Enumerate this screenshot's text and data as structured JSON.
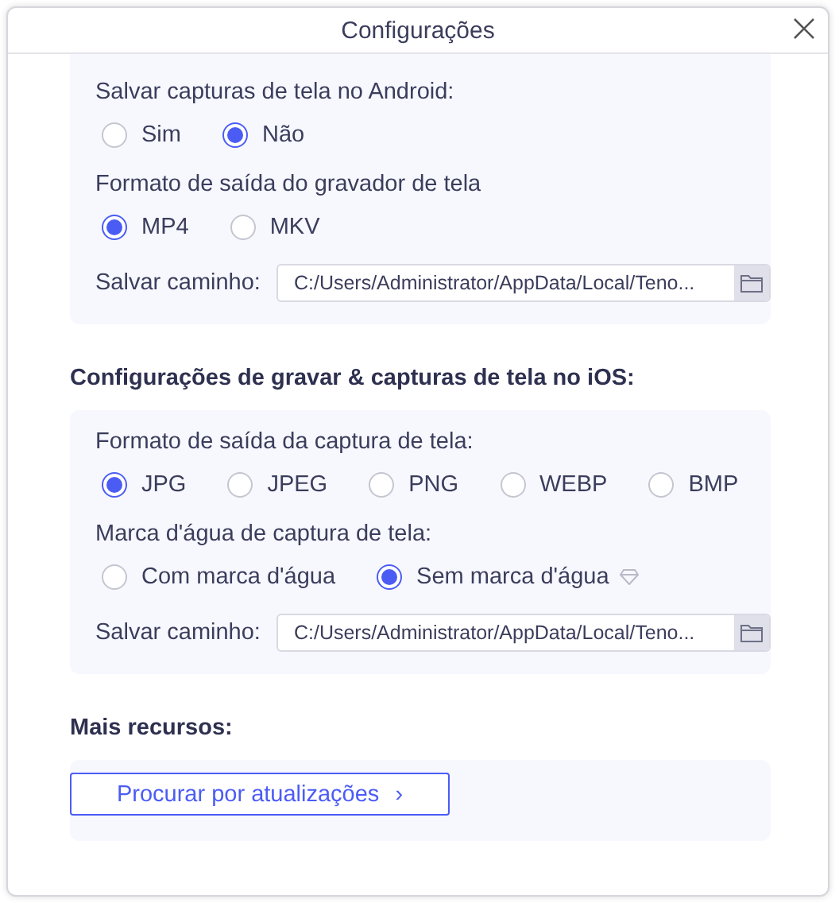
{
  "window": {
    "title": "Configurações"
  },
  "panels": [
    {
      "items": [
        {
          "kind": "radio_group",
          "label": "Salvar capturas de tela no Android:",
          "options": [
            {
              "label": "Sim",
              "selected": false
            },
            {
              "label": "Não",
              "selected": true
            }
          ]
        },
        {
          "kind": "radio_group",
          "label": "Formato de saída do gravador de tela",
          "options": [
            {
              "label": "MP4",
              "selected": true
            },
            {
              "label": "MKV",
              "selected": false
            }
          ]
        },
        {
          "kind": "path",
          "label": "Salvar caminho:",
          "value": "C:/Users/Administrator/AppData/Local/Teno..."
        }
      ]
    },
    {
      "heading": "Configurações de gravar & capturas de tela no iOS:",
      "items": [
        {
          "kind": "radio_group",
          "label": "Formato de saída da captura de tela:",
          "options": [
            {
              "label": "JPG",
              "selected": true
            },
            {
              "label": "JPEG",
              "selected": false
            },
            {
              "label": "PNG",
              "selected": false
            },
            {
              "label": "WEBP",
              "selected": false
            },
            {
              "label": "BMP",
              "selected": false
            }
          ]
        },
        {
          "kind": "radio_group",
          "label": "Marca d'água de captura de tela:",
          "options": [
            {
              "label": "Com marca d'água",
              "selected": false,
              "premium": false
            },
            {
              "label": "Sem marca d'água",
              "selected": true,
              "premium": true
            }
          ]
        },
        {
          "kind": "path",
          "label": "Salvar caminho:",
          "value": "C:/Users/Administrator/AppData/Local/Teno..."
        }
      ]
    },
    {
      "heading": "Mais recursos:",
      "items": [
        {
          "kind": "button",
          "label": "Procurar por atualizações",
          "chevron": "›"
        }
      ]
    }
  ]
}
